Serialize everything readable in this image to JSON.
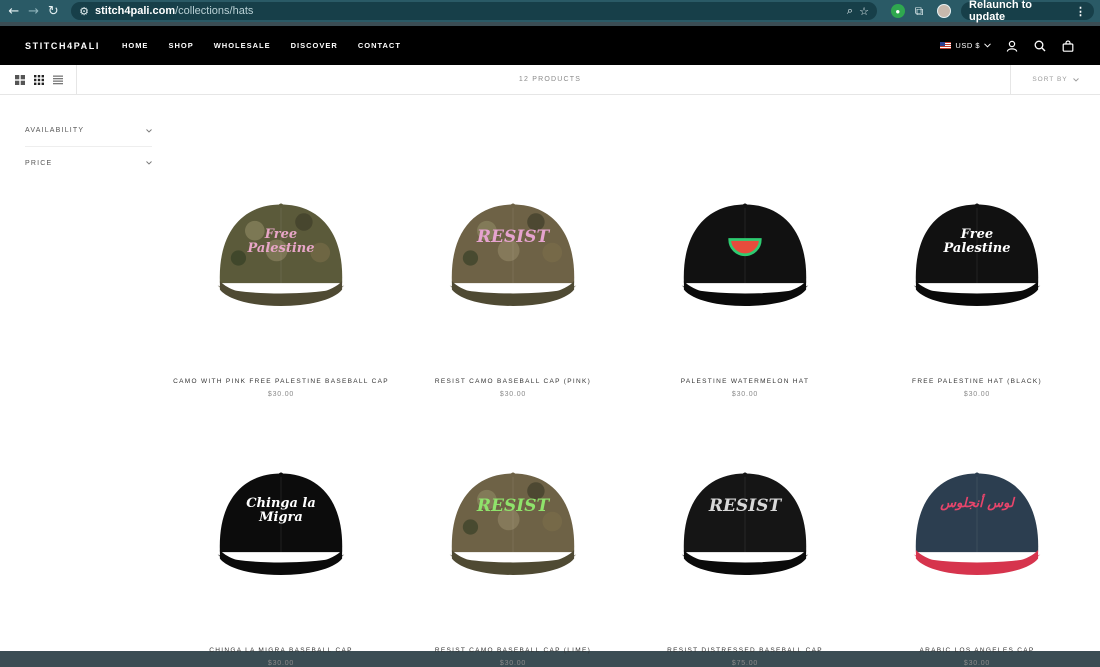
{
  "browser": {
    "url_host": "stitch4pali.com",
    "url_path": "/collections/hats",
    "relaunch_label": "Relaunch to update"
  },
  "store": {
    "logo": "STITCH4PALI",
    "nav": [
      "HOME",
      "SHOP",
      "WHOLESALE",
      "DISCOVER",
      "CONTACT"
    ],
    "currency": "USD $"
  },
  "toolbar": {
    "count": "12 PRODUCTS",
    "sort_label": "SORT BY"
  },
  "filters": [
    "AVAILABILITY",
    "PRICE"
  ],
  "products": [
    {
      "name": "CAMO WITH PINK FREE PALESTINE BASEBALL CAP",
      "price": "$30.00",
      "cap_text": "Free Palestine",
      "crown": "#5b5a3a",
      "text_color": "#e8a6c8"
    },
    {
      "name": "RESIST CAMO BASEBALL CAP (PINK)",
      "price": "$30.00",
      "cap_text": "RESIST",
      "crown": "#6e6246",
      "text_color": "#e6a3cf"
    },
    {
      "name": "PALESTINE WATERMELON HAT",
      "price": "$30.00",
      "cap_text": "",
      "crown": "#111111",
      "text_color": "#e74c3c"
    },
    {
      "name": "FREE PALESTINE HAT (BLACK)",
      "price": "$30.00",
      "cap_text": "Free Palestine",
      "crown": "#111111",
      "text_color": "#ffffff"
    },
    {
      "name": "CHINGA LA MIGRA BASEBALL CAP",
      "price": "$30.00",
      "cap_text": "Chinga la Migra",
      "crown": "#0c0c0c",
      "text_color": "#ffffff"
    },
    {
      "name": "RESIST CAMO BASEBALL CAP (LIME)",
      "price": "$30.00",
      "cap_text": "RESIST",
      "crown": "#6e6246",
      "text_color": "#8fe36b"
    },
    {
      "name": "RESIST DISTRESSED BASEBALL CAP",
      "price": "$75.00",
      "cap_text": "RESIST",
      "crown": "#151515",
      "text_color": "#d8d8d8"
    },
    {
      "name": "ARABIC LOS ANGELES CAP",
      "price": "$30.00",
      "cap_text": "لوس أنجلوس",
      "crown": "#2c3e50",
      "text_color": "#e8456b"
    }
  ]
}
